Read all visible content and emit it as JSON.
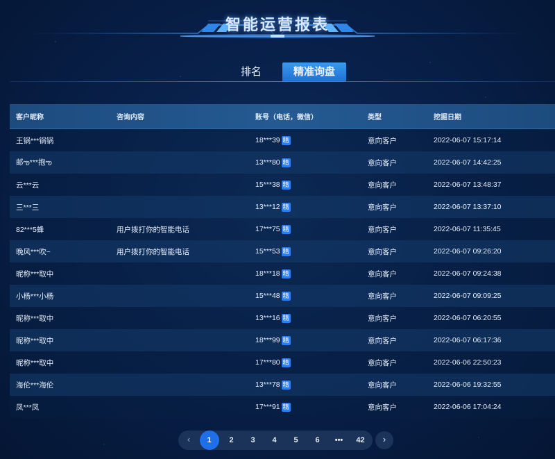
{
  "header": {
    "title": "智能运营报表"
  },
  "tabs": [
    {
      "label": "排名",
      "active": false
    },
    {
      "label": "精准询盘",
      "active": true
    }
  ],
  "table": {
    "columns": [
      "客户昵称",
      "咨询内容",
      "账号（电话，微信）",
      "类型",
      "挖掘日期"
    ],
    "badge_label": "精",
    "rows": [
      {
        "name": "王锅***锅锅",
        "inquiry": "",
        "account": "18***39",
        "type": "意向客户",
        "date": "2022-06-07 15:17:14"
      },
      {
        "name": "邮ఌ***抱ఌ",
        "inquiry": "",
        "account": "13***80",
        "type": "意向客户",
        "date": "2022-06-07 14:42:25"
      },
      {
        "name": "云***云",
        "inquiry": "",
        "account": "15***38",
        "type": "意向客户",
        "date": "2022-06-07 13:48:37"
      },
      {
        "name": "三***三",
        "inquiry": "",
        "account": "13***12",
        "type": "意向客户",
        "date": "2022-06-07 13:37:10"
      },
      {
        "name": "82***5蜂",
        "inquiry": "用户拨打你的智能电话",
        "account": "17***75",
        "type": "意向客户",
        "date": "2022-06-07 11:35:45"
      },
      {
        "name": "晚风***吹~",
        "inquiry": "用户拨打你的智能电话",
        "account": "15***53",
        "type": "意向客户",
        "date": "2022-06-07 09:26:20"
      },
      {
        "name": "昵称***取中",
        "inquiry": "",
        "account": "18***18",
        "type": "意向客户",
        "date": "2022-06-07 09:24:38"
      },
      {
        "name": "小杨***小杨",
        "inquiry": "",
        "account": "15***48",
        "type": "意向客户",
        "date": "2022-06-07 09:09:25"
      },
      {
        "name": "昵称***取中",
        "inquiry": "",
        "account": "13***16",
        "type": "意向客户",
        "date": "2022-06-07 06:20:55"
      },
      {
        "name": "昵称***取中",
        "inquiry": "",
        "account": "18***99",
        "type": "意向客户",
        "date": "2022-06-07 06:17:36"
      },
      {
        "name": "昵称***取中",
        "inquiry": "",
        "account": "17***80",
        "type": "意向客户",
        "date": "2022-06-06 22:50:23"
      },
      {
        "name": "海伦***海伦",
        "inquiry": "",
        "account": "13***78",
        "type": "意向客户",
        "date": "2022-06-06 19:32:55"
      },
      {
        "name": "凤***凤",
        "inquiry": "",
        "account": "17***91",
        "type": "意向客户",
        "date": "2022-06-06 17:04:24"
      }
    ]
  },
  "pagination": {
    "prev_icon": "chevron-left-icon",
    "next_icon": "chevron-right-icon",
    "prev_glyph": "‹",
    "next_glyph": "›",
    "pages": [
      "1",
      "2",
      "3",
      "4",
      "5",
      "6",
      "•••",
      "42"
    ],
    "current": "1"
  },
  "colors": {
    "background": "#08204a",
    "accent": "#1f6fe8",
    "tab_active": "#2f86e6",
    "badge": "#2f7ef0"
  }
}
